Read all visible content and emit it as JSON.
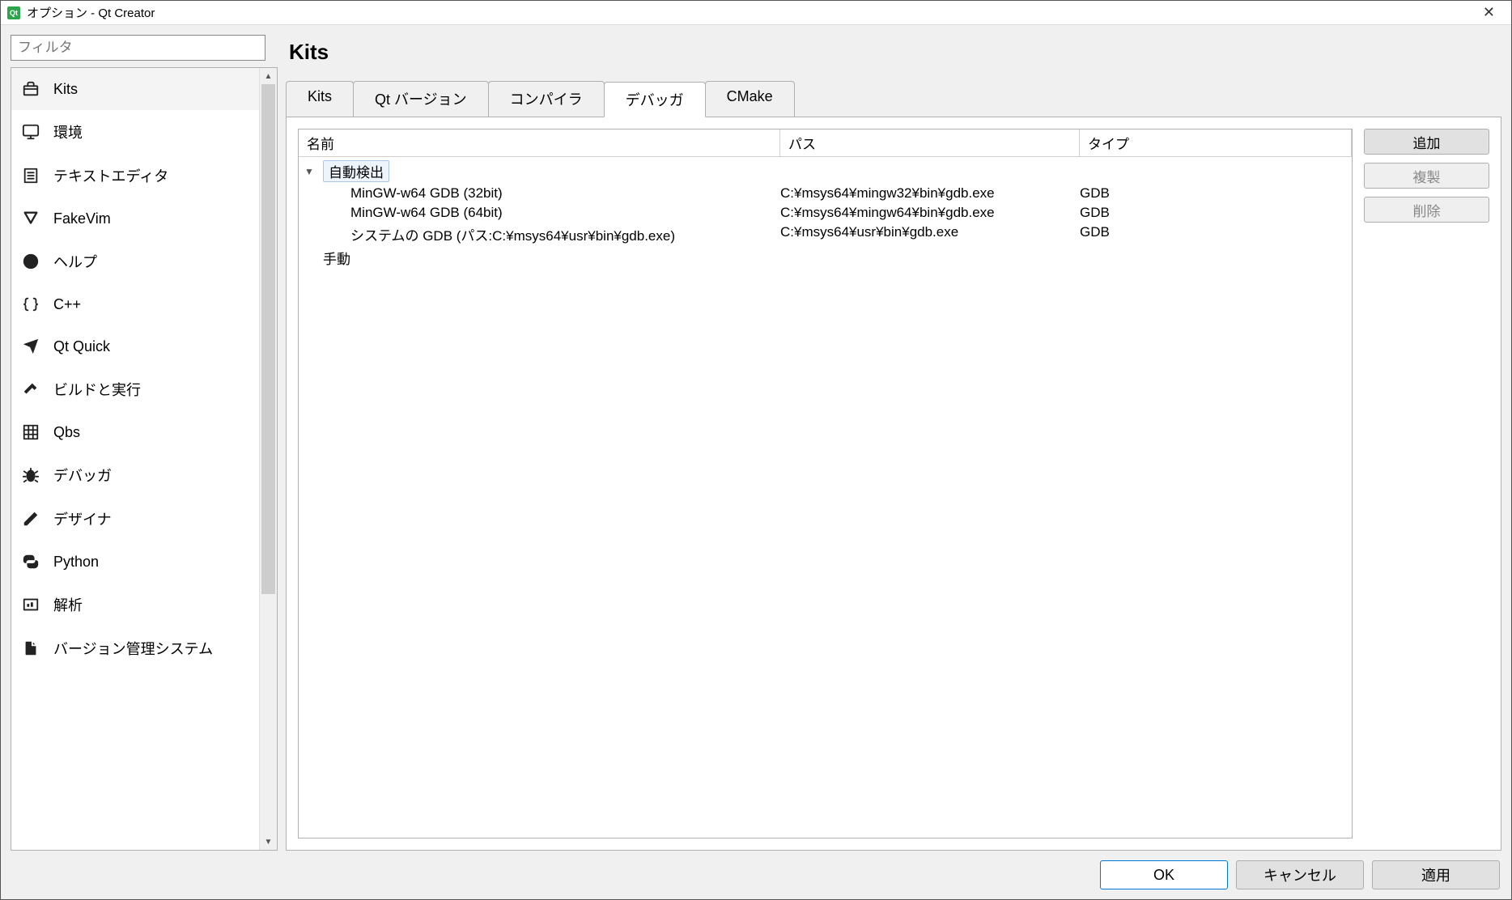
{
  "window": {
    "title": "オプション - Qt Creator"
  },
  "filter": {
    "placeholder": "フィルタ"
  },
  "sidebar": {
    "items": [
      {
        "label": "Kits",
        "icon": "kits-icon",
        "selected": true
      },
      {
        "label": "環境",
        "icon": "monitor-icon"
      },
      {
        "label": "テキストエディタ",
        "icon": "document-lines-icon"
      },
      {
        "label": "FakeVim",
        "icon": "fakevim-icon"
      },
      {
        "label": "ヘルプ",
        "icon": "help-icon"
      },
      {
        "label": "C++",
        "icon": "braces-icon"
      },
      {
        "label": "Qt Quick",
        "icon": "send-icon"
      },
      {
        "label": "ビルドと実行",
        "icon": "hammer-icon"
      },
      {
        "label": "Qbs",
        "icon": "grid-icon"
      },
      {
        "label": "デバッガ",
        "icon": "bug-icon"
      },
      {
        "label": "デザイナ",
        "icon": "pencil-icon"
      },
      {
        "label": "Python",
        "icon": "python-icon"
      },
      {
        "label": "解析",
        "icon": "gauge-icon"
      },
      {
        "label": "バージョン管理システム",
        "icon": "vcs-icon"
      }
    ]
  },
  "page": {
    "title": "Kits"
  },
  "tabs": [
    {
      "label": "Kits"
    },
    {
      "label": "Qt バージョン"
    },
    {
      "label": "コンパイラ"
    },
    {
      "label": "デバッガ",
      "active": true
    },
    {
      "label": "CMake"
    }
  ],
  "tree": {
    "headers": {
      "name": "名前",
      "path": "パス",
      "type": "タイプ"
    },
    "groups": [
      {
        "label": "自動検出",
        "expanded": true,
        "selected": true,
        "rows": [
          {
            "name": "MinGW-w64 GDB (32bit)",
            "path": "C:¥msys64¥mingw32¥bin¥gdb.exe",
            "type": "GDB"
          },
          {
            "name": "MinGW-w64 GDB (64bit)",
            "path": "C:¥msys64¥mingw64¥bin¥gdb.exe",
            "type": "GDB"
          },
          {
            "name": "システムの GDB (パス:C:¥msys64¥usr¥bin¥gdb.exe)",
            "path": "C:¥msys64¥usr¥bin¥gdb.exe",
            "type": "GDB"
          }
        ]
      },
      {
        "label": "手動",
        "expanded": false,
        "rows": []
      }
    ]
  },
  "sideButtons": {
    "add": "追加",
    "clone": "複製",
    "remove": "削除"
  },
  "footer": {
    "ok": "OK",
    "cancel": "キャンセル",
    "apply": "適用"
  }
}
